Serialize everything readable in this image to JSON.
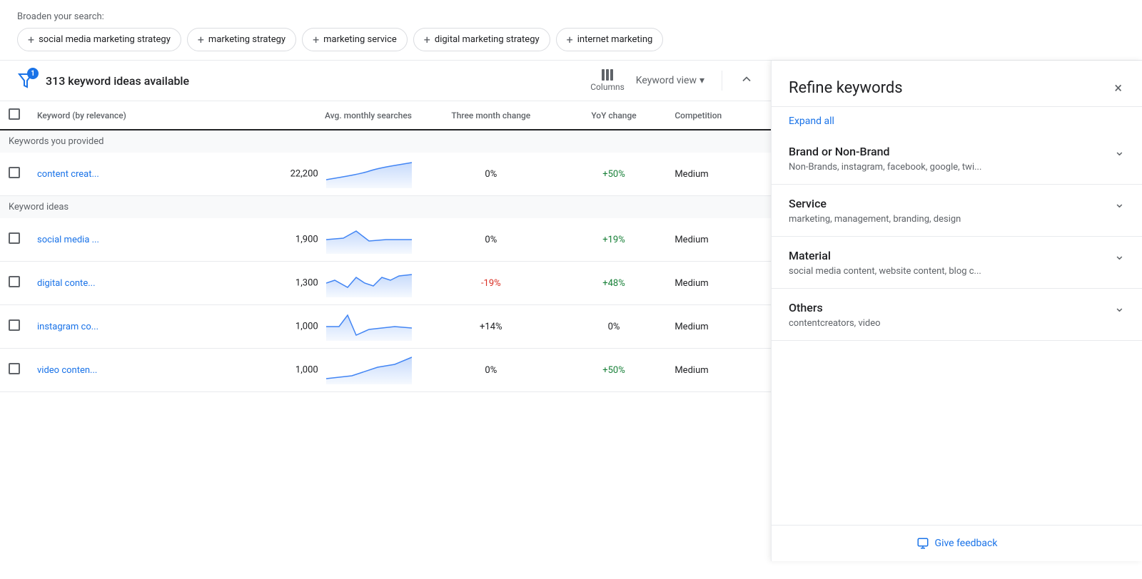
{
  "broaden": {
    "label": "Broaden your search:",
    "chips": [
      "social media marketing strategy",
      "marketing strategy",
      "marketing service",
      "digital marketing strategy",
      "internet marketing"
    ]
  },
  "toolbar": {
    "filter_badge": "1",
    "keyword_count": "313 keyword ideas available",
    "columns_label": "Columns",
    "view_label": "Keyword view"
  },
  "table": {
    "headers": {
      "keyword": "Keyword (by relevance)",
      "avg_monthly": "Avg. monthly searches",
      "three_month": "Three month change",
      "yoy": "YoY change",
      "competition": "Competition"
    },
    "section1_label": "Keywords you provided",
    "section2_label": "Keyword ideas",
    "rows": [
      {
        "keyword": "content creat...",
        "avg_monthly": "22,200",
        "three_month": "0%",
        "yoy": "+50%",
        "competition": "Medium",
        "spark_type": "up"
      },
      {
        "keyword": "social media ...",
        "avg_monthly": "1,900",
        "three_month": "0%",
        "yoy": "+19%",
        "competition": "Medium",
        "spark_type": "spike"
      },
      {
        "keyword": "digital conte...",
        "avg_monthly": "1,300",
        "three_month": "-19%",
        "yoy": "+48%",
        "competition": "Medium",
        "spark_type": "wavy"
      },
      {
        "keyword": "instagram co...",
        "avg_monthly": "1,000",
        "three_month": "+14%",
        "yoy": "0%",
        "competition": "Medium",
        "spark_type": "spike2"
      },
      {
        "keyword": "video conten...",
        "avg_monthly": "1,000",
        "three_month": "0%",
        "yoy": "+50%",
        "competition": "Medium",
        "spark_type": "up2"
      }
    ]
  },
  "panel": {
    "title": "Refine keywords",
    "expand_all": "Expand all",
    "close_label": "×",
    "items": [
      {
        "title": "Brand or Non-Brand",
        "subtitle": "Non-Brands, instagram, facebook, google, twi..."
      },
      {
        "title": "Service",
        "subtitle": "marketing, management, branding, design"
      },
      {
        "title": "Material",
        "subtitle": "social media content, website content, blog c..."
      },
      {
        "title": "Others",
        "subtitle": "contentcreators, video"
      }
    ],
    "feedback_label": "Give feedback"
  }
}
